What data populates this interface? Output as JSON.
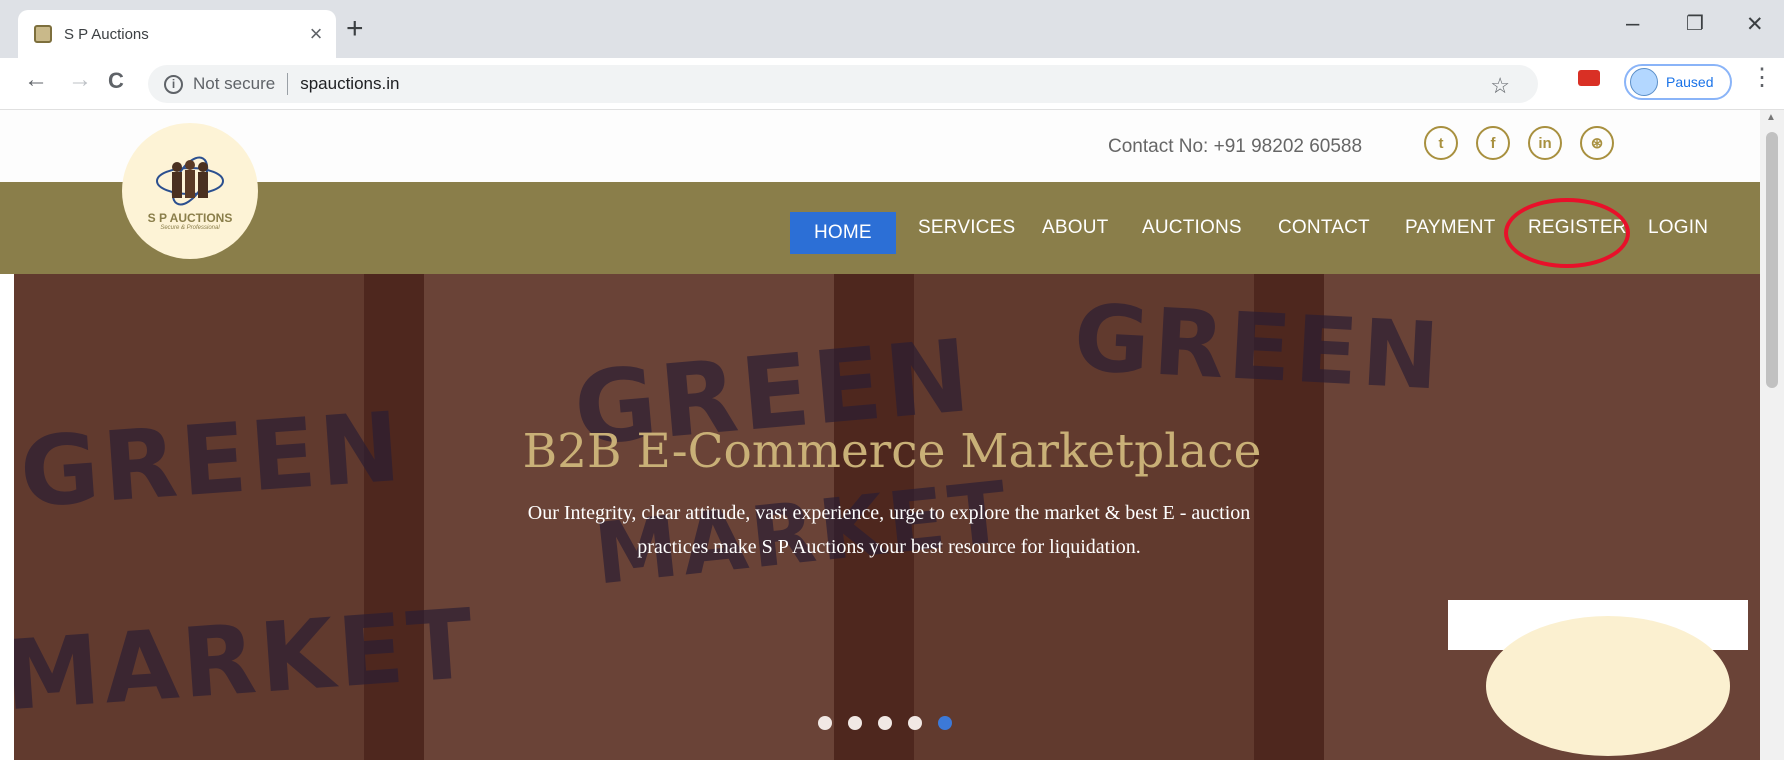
{
  "browser": {
    "tab_title": "S P Auctions",
    "tab_close": "×",
    "new_tab": "+",
    "window_controls": {
      "minimize": "–",
      "restore": "❐",
      "close": "✕"
    },
    "nav": {
      "back": "←",
      "forward": "→",
      "reload": "C"
    },
    "security_icon": "i",
    "security_text": "Not secure",
    "url": "spauctions.in",
    "bookmark": "☆",
    "profile_status": "Paused",
    "menu": "⋮"
  },
  "site": {
    "contact": "Contact No: +91 98202 60588",
    "social": [
      {
        "icon": "twitter-icon",
        "glyph": "t"
      },
      {
        "icon": "facebook-icon",
        "glyph": "f"
      },
      {
        "icon": "linkedin-icon",
        "glyph": "in"
      },
      {
        "icon": "dribbble-icon",
        "glyph": "⊛"
      }
    ],
    "logo": {
      "name": "S P AUCTIONS",
      "tagline": "Secure & Professional"
    },
    "nav": [
      "HOME",
      "SERVICES",
      "ABOUT",
      "AUCTIONS",
      "CONTACT",
      "PAYMENT",
      "REGISTER",
      "LOGIN"
    ],
    "active_nav": "HOME",
    "highlighted_nav": "REGISTER"
  },
  "hero": {
    "title": "B2B E-Commerce Marketplace",
    "subtitle": "Our Integrity, clear attitude, vast experience, urge to explore the market & best E - auction practices make S P Auctions your best resource for liquidation.",
    "crate_words": [
      "GREEN",
      "MARKET"
    ],
    "slides": 5,
    "active_slide": 5
  },
  "colors": {
    "nav_bg": "#8a7e4a",
    "nav_active": "#2c6fd6",
    "hero_title": "#c9b077",
    "highlight_ring": "#e8102a"
  }
}
